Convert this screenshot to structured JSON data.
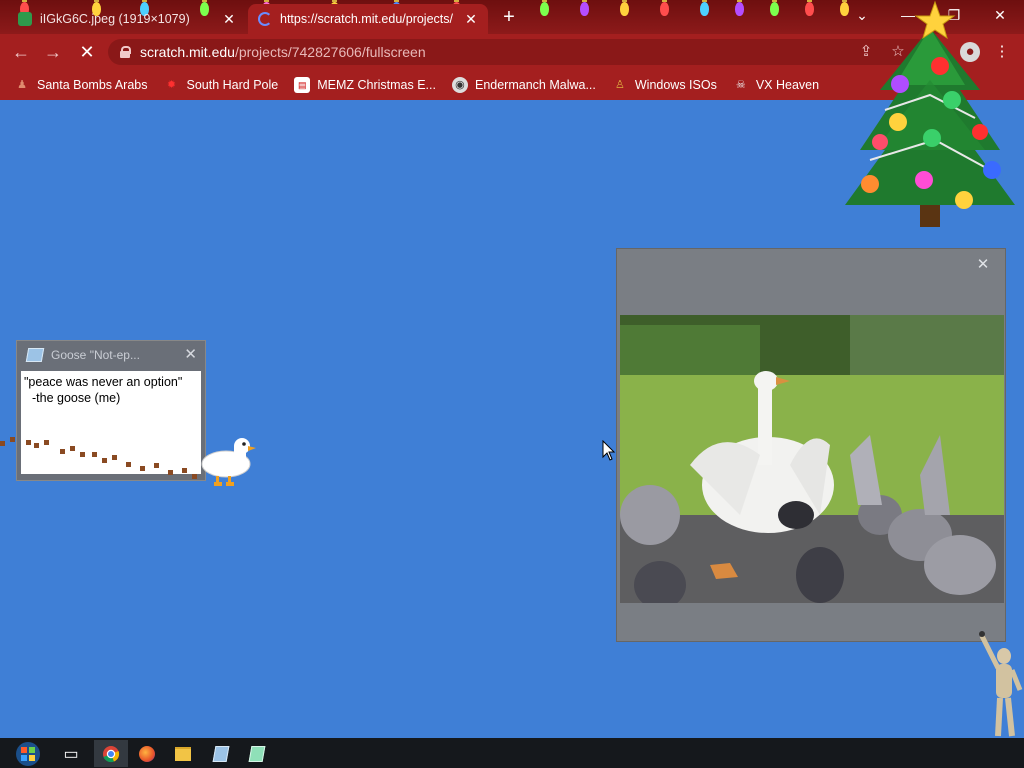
{
  "browser": {
    "tabs": [
      {
        "label": "iIGkG6C.jpeg (1919×1079)",
        "active": false
      },
      {
        "label": "https://scratch.mit.edu/projects/",
        "active": true
      }
    ],
    "url_host": "scratch.mit.edu",
    "url_path": "/projects/742827606/fullscreen",
    "bookmarks": [
      {
        "label": "Santa Bombs Arabs",
        "icon": "figure-icon"
      },
      {
        "label": "South Hard Pole",
        "icon": "red-gear-icon"
      },
      {
        "label": "MEMZ Christmas E...",
        "icon": "page-icon"
      },
      {
        "label": "Endermanch Malwa...",
        "icon": "raccoon-icon"
      },
      {
        "label": "Windows ISOs",
        "icon": "person-icon"
      },
      {
        "label": "VX Heaven",
        "icon": "skull-icon"
      }
    ]
  },
  "note": {
    "title": "Goose \"Not-ep...",
    "line1": "\"peace was never an option\"",
    "line2": "-the goose (me)"
  },
  "colors": {
    "desktop": "#3f7fd6",
    "chrome": "#a41f1f",
    "taskbar": "#15181c"
  }
}
